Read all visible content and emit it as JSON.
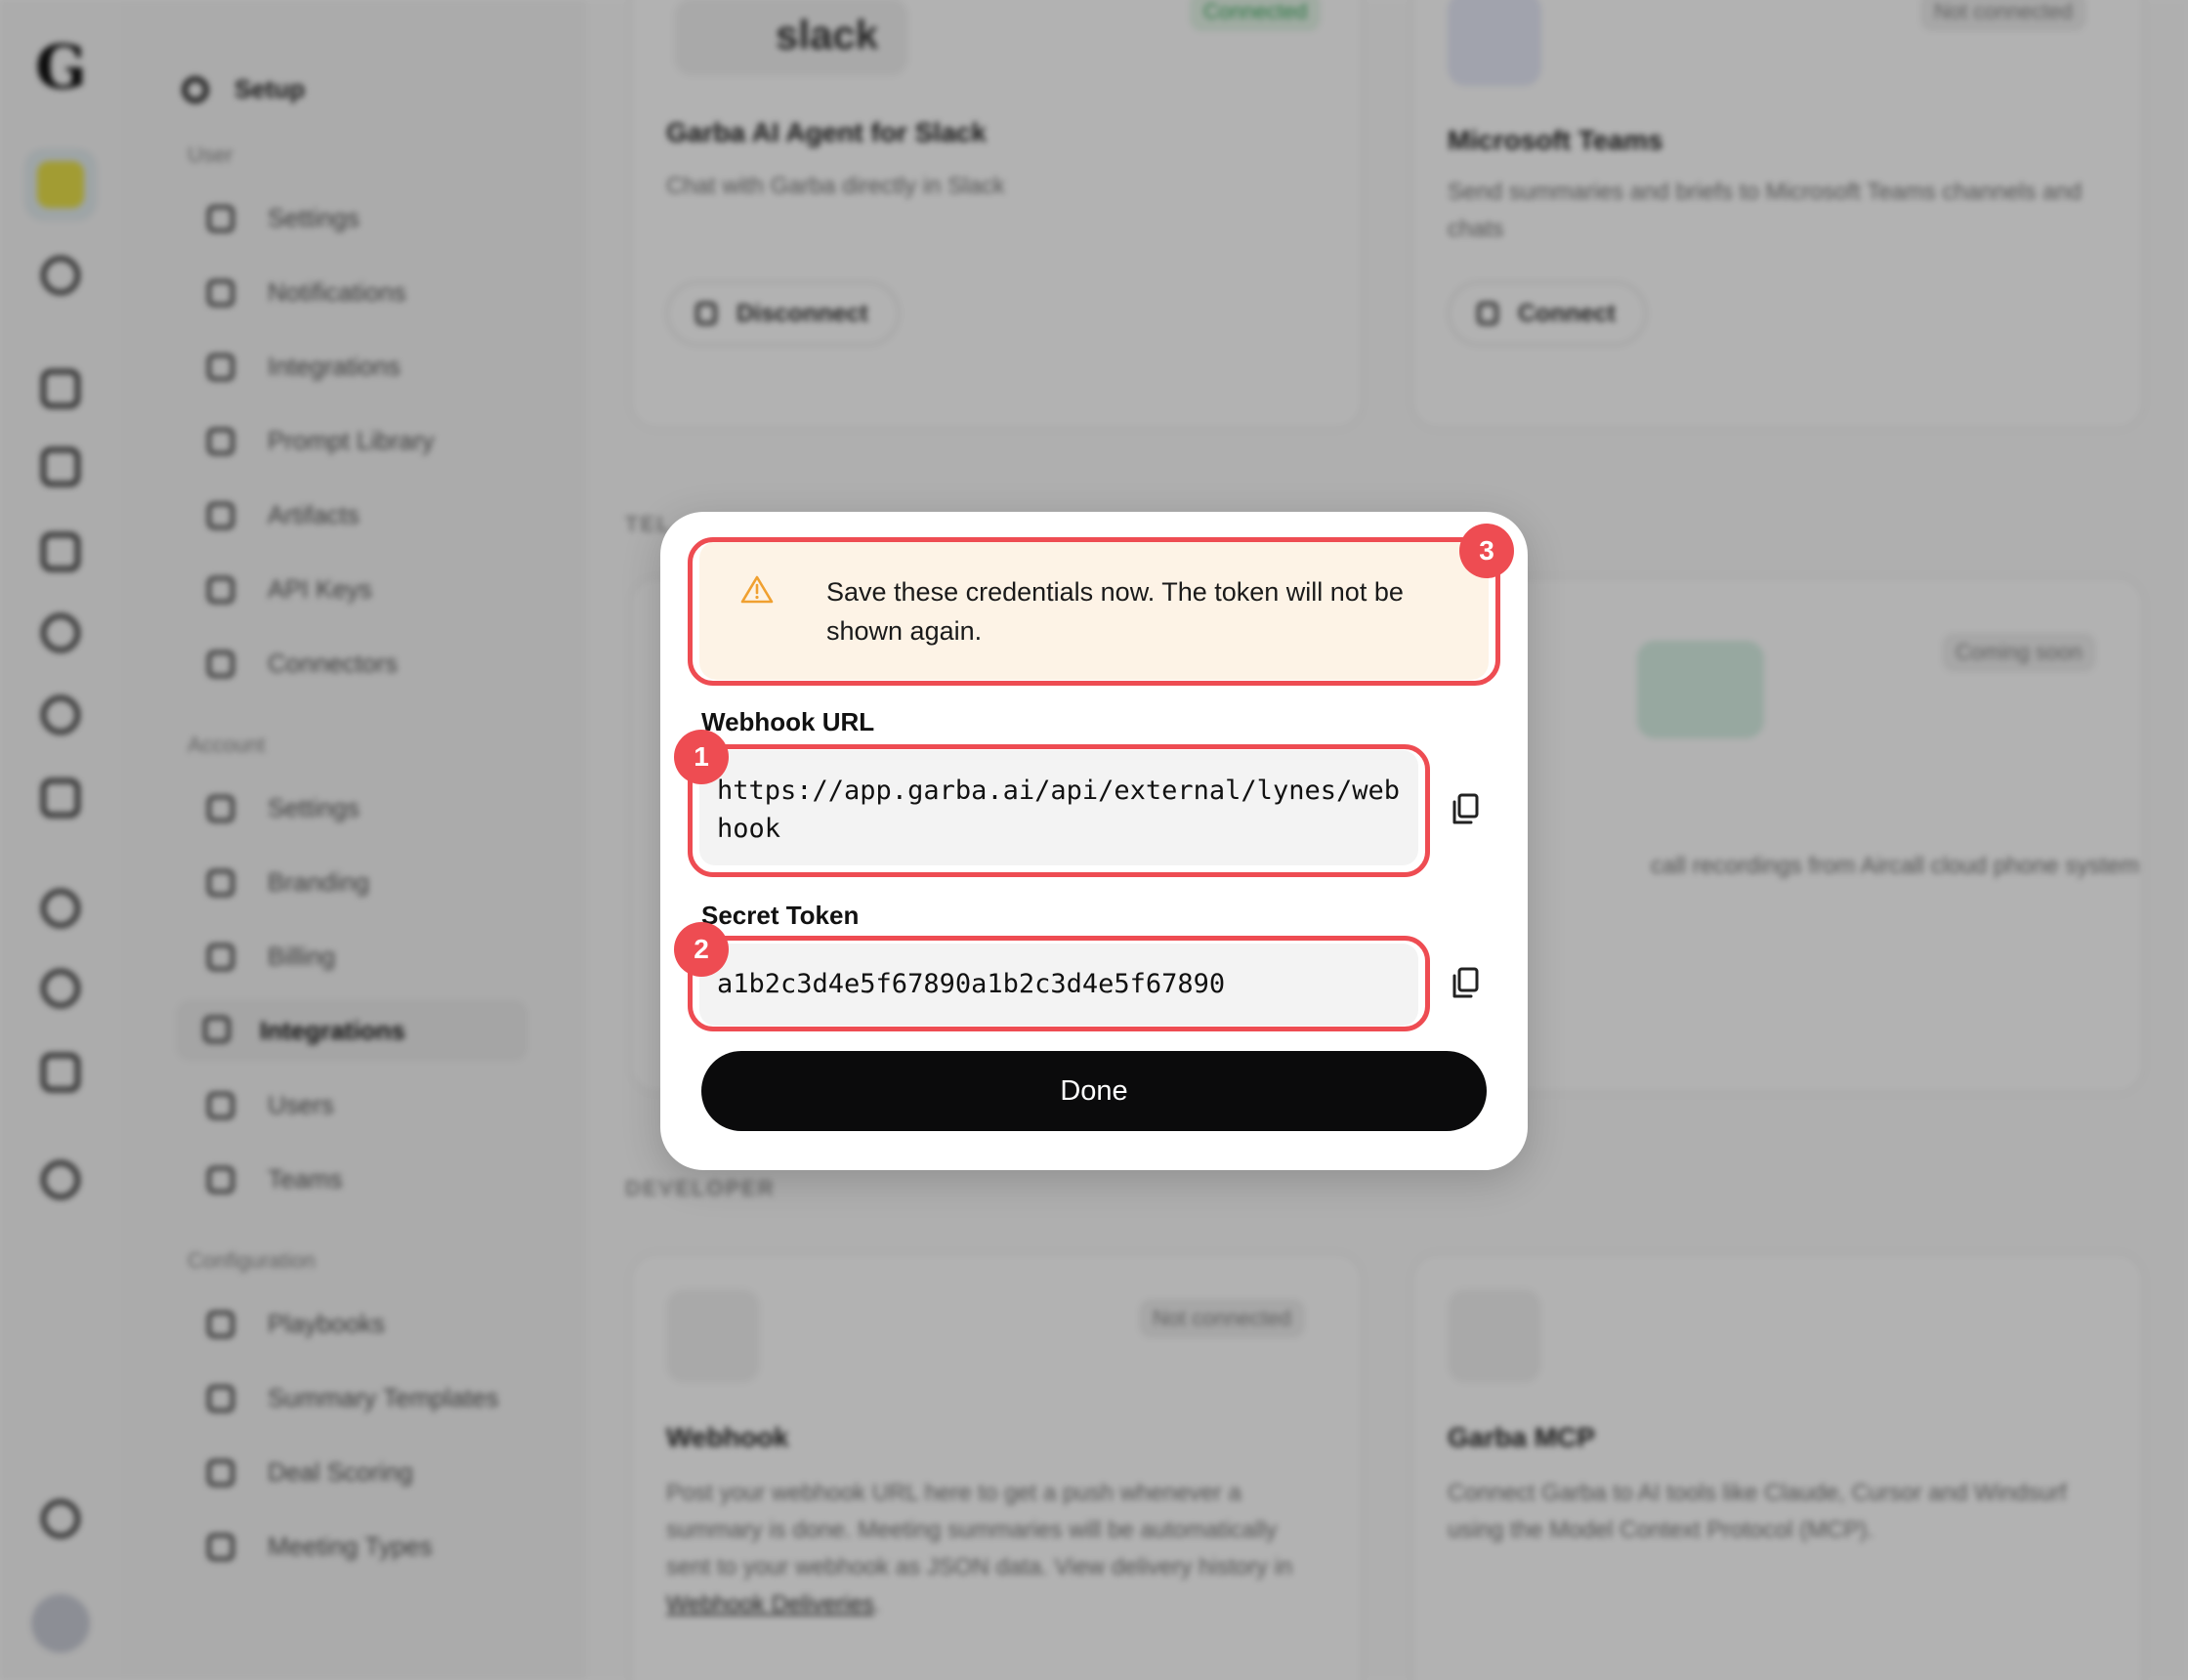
{
  "colors": {
    "accent_annotation": "#ee4c52",
    "warning_bg": "#fdf3e6",
    "warning_icon": "#f0a030",
    "primary_button": "#0b0b0c",
    "connected_green": "#3ea860"
  },
  "sidebar": {
    "title": "Setup",
    "sections": [
      {
        "label": "User",
        "items": [
          "Settings",
          "Notifications",
          "Integrations",
          "Prompt Library",
          "Artifacts",
          "API Keys",
          "Connectors"
        ]
      },
      {
        "label": "Account",
        "items": [
          "Settings",
          "Branding",
          "Billing",
          "Integrations",
          "Users",
          "Teams"
        ]
      },
      {
        "label": "Configuration",
        "items": [
          "Playbooks",
          "Summary Templates",
          "Deal Scoring",
          "Meeting Types"
        ]
      }
    ],
    "active_item": "Integrations"
  },
  "cards": {
    "slack": {
      "logo_text": "slack",
      "badge": "Connected",
      "title": "Garba AI Agent for Slack",
      "desc": "Chat with Garba directly in Slack",
      "button": "Disconnect"
    },
    "teams": {
      "badge": "Not connected",
      "title": "Microsoft Teams",
      "desc": "Send summaries and briefs to Microsoft Teams channels and chats",
      "button": "Connect"
    },
    "telephony_section": "TEL",
    "aircall": {
      "badge": "Coming soon",
      "desc": "call recordings from Aircall cloud phone system"
    },
    "developer_section": "DEVELOPER",
    "webhook": {
      "badge": "Not connected",
      "title": "Webhook",
      "desc": "Post your webhook URL here to get a push whenever a summary is done. Meeting summaries will be automatically sent to your webhook as JSON data. View delivery history in",
      "link": "Webhook Deliveries",
      "desc_end": "."
    },
    "mcp": {
      "title": "Garba MCP",
      "desc": "Connect Garba to AI tools like Claude, Cursor and Windsurf using the Model Context Protocol (MCP)."
    }
  },
  "modal": {
    "warning": "Save these credentials now. The token will not be shown again.",
    "webhook_label": "Webhook URL",
    "webhook_url": "https://app.garba.ai/api/external/lynes/webhook",
    "token_label": "Secret Token",
    "secret_token": "a1b2c3d4e5f67890a1b2c3d4e5f67890",
    "done_label": "Done"
  },
  "annotations": {
    "n1": "1",
    "n2": "2",
    "n3": "3"
  }
}
